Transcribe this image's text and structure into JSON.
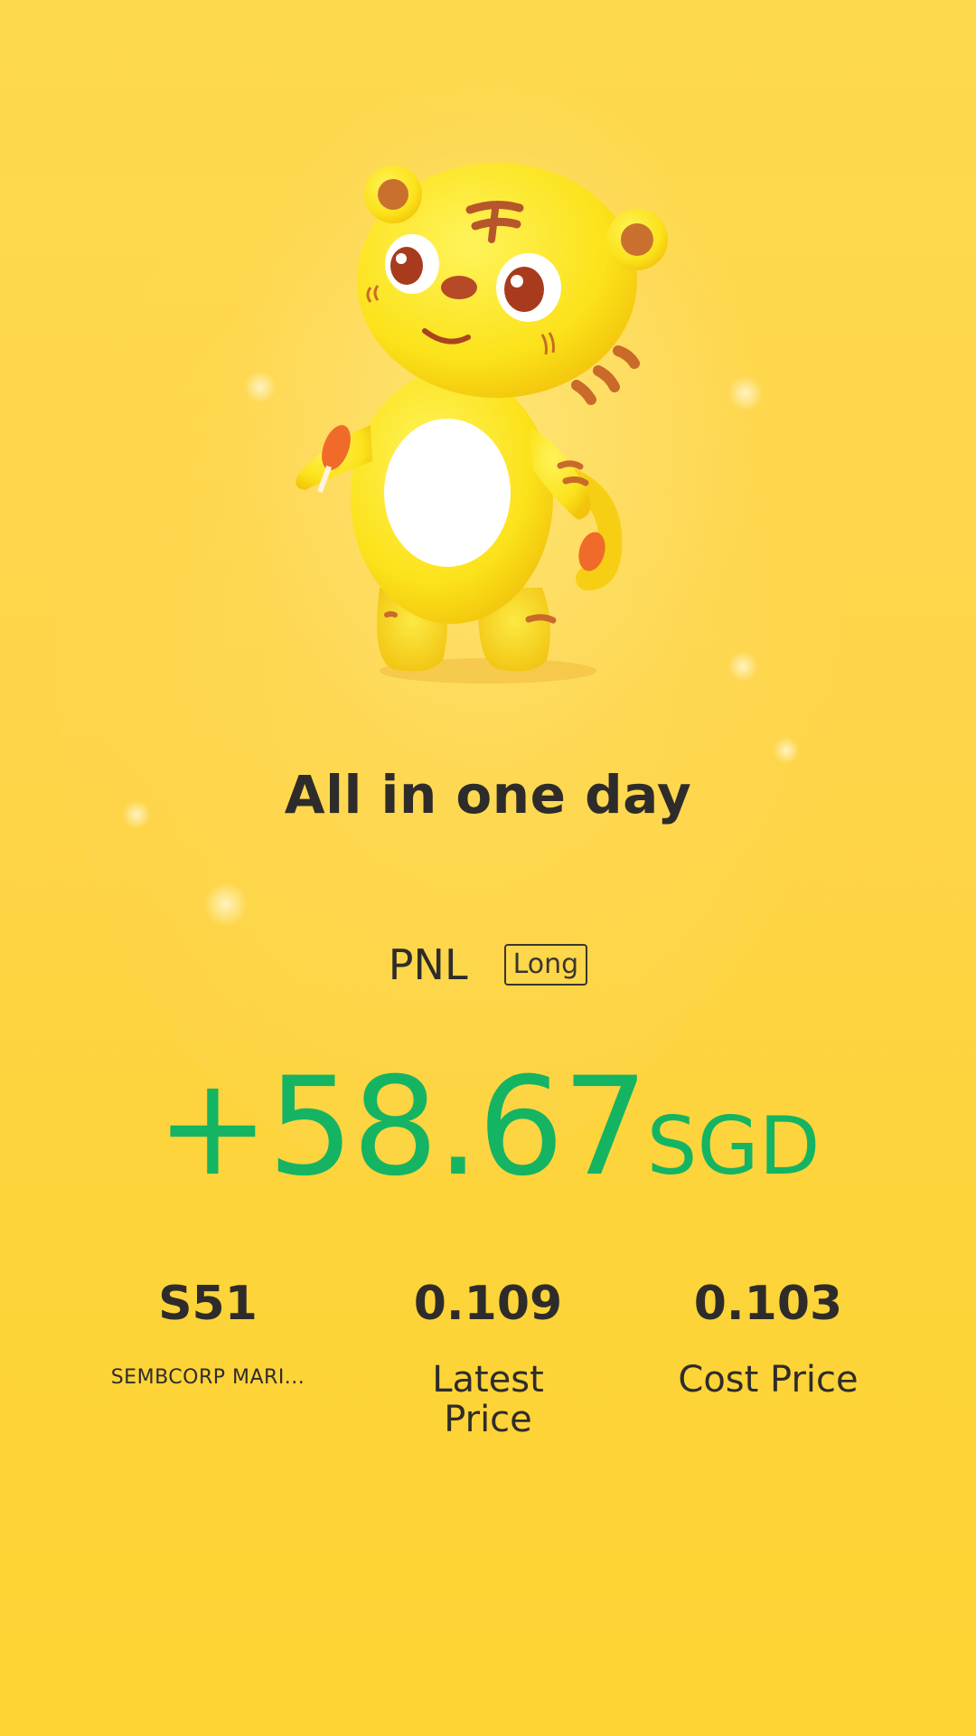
{
  "title": "All in one day",
  "pnl": {
    "label": "PNL",
    "badge": "Long",
    "amount": "+58.67",
    "currency": "SGD"
  },
  "stats": [
    {
      "value": "S51",
      "label": "SEMBCORP MARI..."
    },
    {
      "value": "0.109",
      "label": "Latest\nPrice"
    },
    {
      "value": "0.103",
      "label": "Cost Price"
    }
  ],
  "colors": {
    "background": "#fdd33c",
    "profit": "#14b463",
    "text": "#2e2c2a"
  }
}
